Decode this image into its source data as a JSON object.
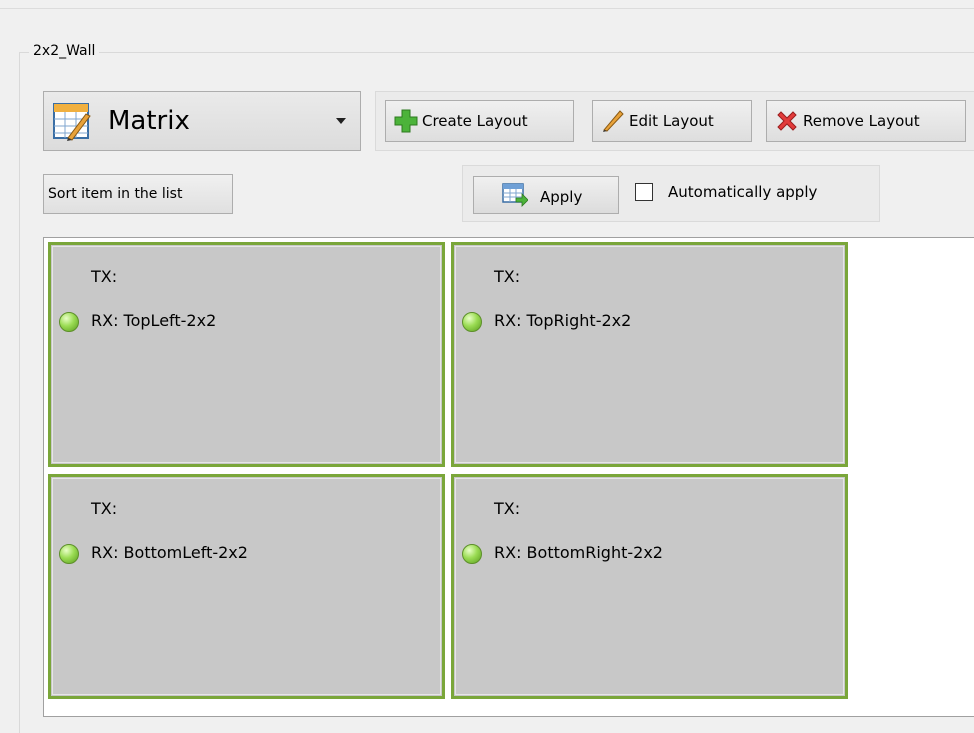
{
  "group": {
    "title": "2x2_Wall"
  },
  "layout_select": {
    "value": "Matrix",
    "icon": "matrix-grid-pencil-icon"
  },
  "toolbar": {
    "create_label": "Create Layout",
    "create_icon": "plus-icon",
    "edit_label": "Edit Layout",
    "edit_icon": "pencil-icon",
    "remove_label": "Remove Layout",
    "remove_icon": "red-x-icon"
  },
  "sort_button": {
    "label": "Sort item in the list"
  },
  "apply": {
    "label": "Apply",
    "icon": "apply-grid-icon",
    "auto_label": "Automatically apply",
    "auto_checked": false
  },
  "wall": {
    "cells": [
      {
        "tx": "TX:",
        "rx": "RX: TopLeft-2x2",
        "status": "online"
      },
      {
        "tx": "TX:",
        "rx": "RX: TopRight-2x2",
        "status": "online"
      },
      {
        "tx": "TX:",
        "rx": "RX: BottomLeft-2x2",
        "status": "online"
      },
      {
        "tx": "TX:",
        "rx": "RX: BottomRight-2x2",
        "status": "online"
      }
    ]
  },
  "colors": {
    "cell_border": "#7aa63a",
    "cell_bg": "#c8c8c8",
    "status_online": "#8fd14f"
  }
}
